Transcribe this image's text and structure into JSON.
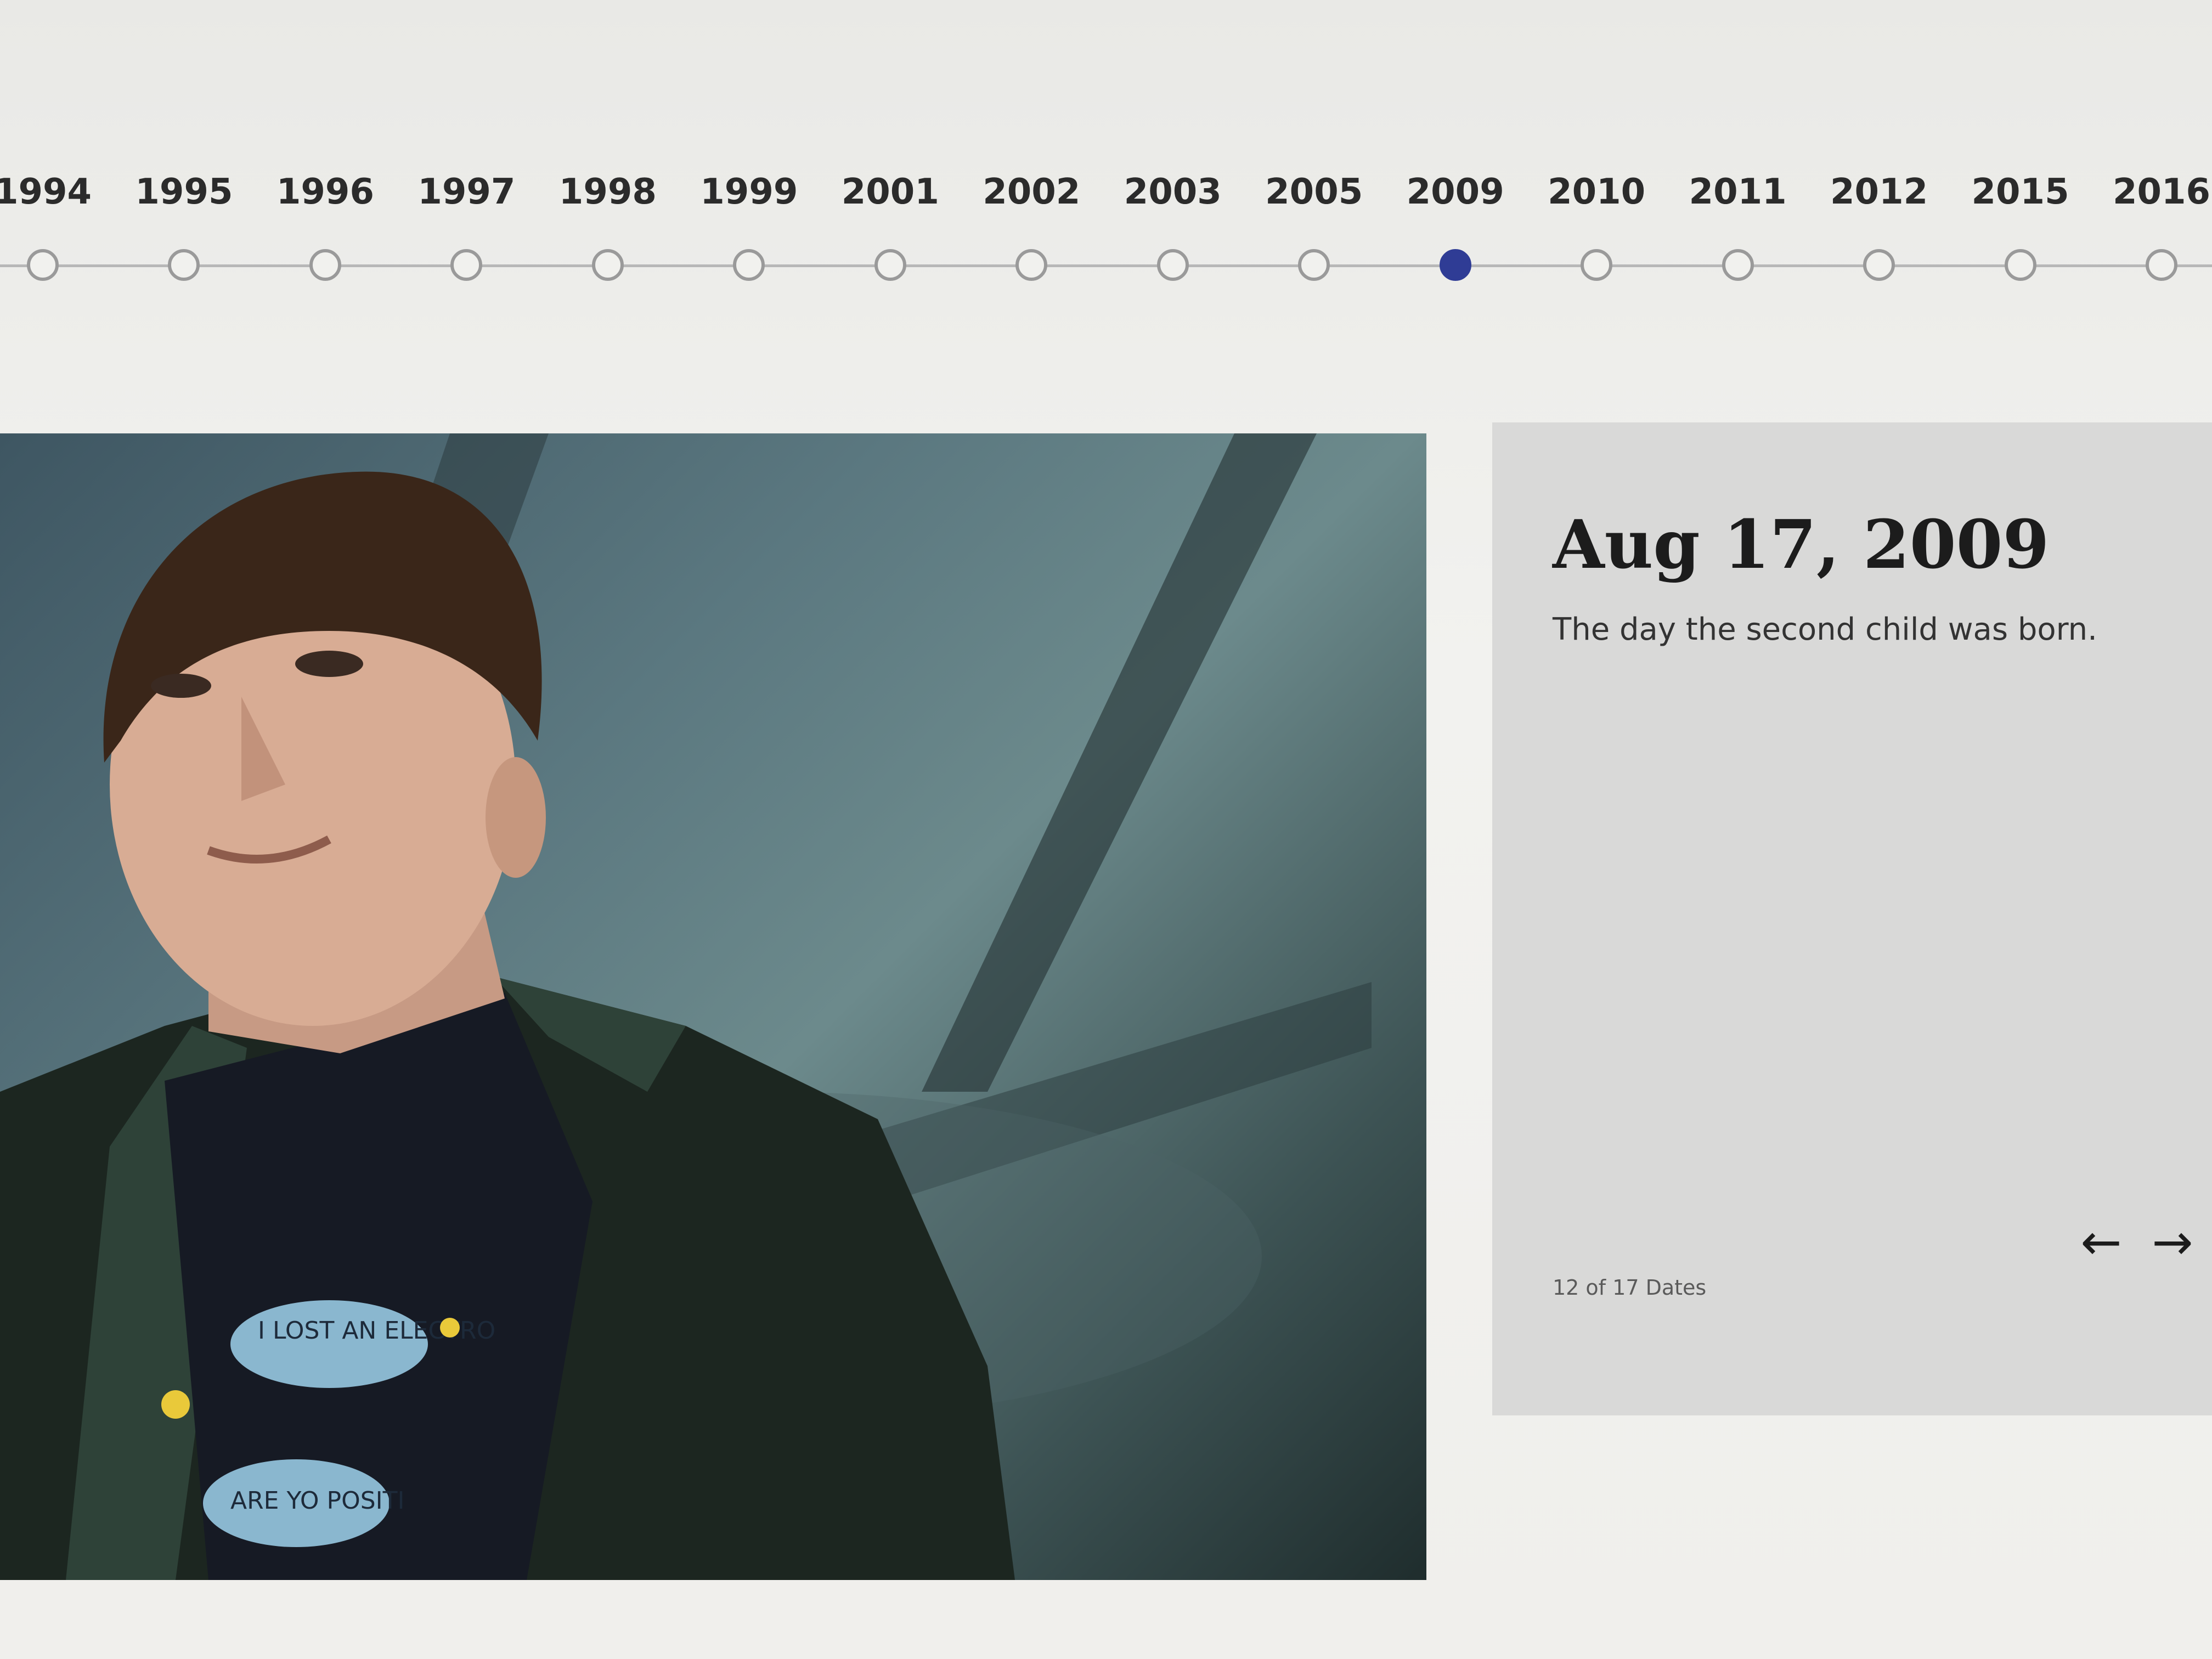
{
  "timeline": {
    "years": [
      {
        "label": "1994",
        "active": false
      },
      {
        "label": "1995",
        "active": false
      },
      {
        "label": "1996",
        "active": false
      },
      {
        "label": "1997",
        "active": false
      },
      {
        "label": "1998",
        "active": false
      },
      {
        "label": "1999",
        "active": false
      },
      {
        "label": "2001",
        "active": false
      },
      {
        "label": "2002",
        "active": false
      },
      {
        "label": "2003",
        "active": false
      },
      {
        "label": "2005",
        "active": false
      },
      {
        "label": "2009",
        "active": true
      },
      {
        "label": "2010",
        "active": false
      },
      {
        "label": "2011",
        "active": false
      },
      {
        "label": "2012",
        "active": false
      },
      {
        "label": "2015",
        "active": false
      },
      {
        "label": "2016",
        "active": false
      }
    ],
    "active_color": "#2f3c95",
    "dot_color": "#9a9a9a"
  },
  "photo": {
    "shirt_text_1": "I LOST AN ELECTRO",
    "shirt_text_2": "ARE YO POSITI"
  },
  "event": {
    "date": "Aug 17, 2009",
    "description": "The day the second child was born.",
    "counter": "12 of 17 Dates"
  },
  "nav": {
    "prev_icon": "←",
    "next_icon": "→"
  }
}
